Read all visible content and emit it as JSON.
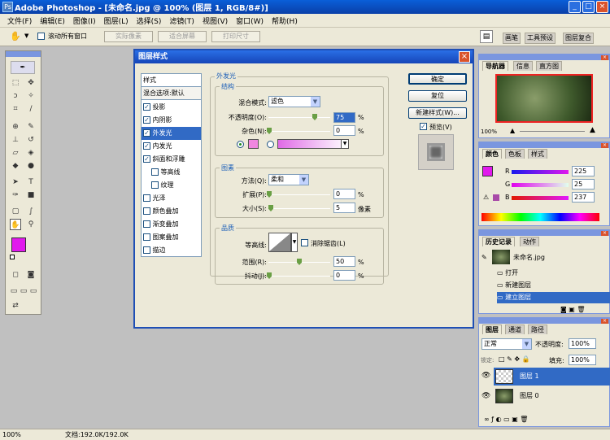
{
  "window": {
    "title": "Adobe Photoshop - [未命名.jpg @ 100% (图层 1, RGB/8#)]"
  },
  "menu": [
    "文件(F)",
    "编辑(E)",
    "图像(I)",
    "图层(L)",
    "选择(S)",
    "滤镜(T)",
    "视图(V)",
    "窗口(W)",
    "帮助(H)"
  ],
  "options": {
    "scroll_all": "滚动所有窗口",
    "actual_pixels": "实际像素",
    "fit_screen": "适合屏幕",
    "print_size": "打印尺寸"
  },
  "palette_well": [
    "画笔",
    "工具预设",
    "图层复合"
  ],
  "status": {
    "zoom": "100%",
    "doc": "文档:192.0K/192.0K"
  },
  "dialog": {
    "title": "图层样式",
    "styles": {
      "header": "样式",
      "blend_defaults": "混合选项:默认",
      "items": [
        {
          "label": "投影",
          "checked": true
        },
        {
          "label": "内阴影",
          "checked": true
        },
        {
          "label": "外发光",
          "checked": true
        },
        {
          "label": "内发光",
          "checked": true
        },
        {
          "label": "斜面和浮雕",
          "checked": true
        },
        {
          "label": "等高线",
          "checked": false
        },
        {
          "label": "纹理",
          "checked": false
        },
        {
          "label": "光泽",
          "checked": false
        },
        {
          "label": "颜色叠加",
          "checked": false
        },
        {
          "label": "渐变叠加",
          "checked": false
        },
        {
          "label": "图案叠加",
          "checked": false
        },
        {
          "label": "描边",
          "checked": false
        }
      ]
    },
    "outer_glow": {
      "title": "外发光",
      "structure": {
        "title": "结构",
        "blend_mode_label": "混合模式:",
        "blend_mode": "滤色",
        "opacity_label": "不透明度(O):",
        "opacity": "75",
        "noise_label": "杂色(N):",
        "noise": "0",
        "percent": "%",
        "color": "#f087e0"
      },
      "elements": {
        "title": "图素",
        "method_label": "方法(Q):",
        "method": "柔和",
        "spread_label": "扩展(P):",
        "spread": "0",
        "size_label": "大小(S):",
        "size": "5",
        "pixels": "像素"
      },
      "quality": {
        "title": "品质",
        "contour_label": "等高线:",
        "antialias": "消除锯齿(L)",
        "range_label": "范围(R):",
        "range": "50",
        "jitter_label": "抖动(J):",
        "jitter": "0"
      }
    },
    "buttons": {
      "ok": "确定",
      "reset": "复位",
      "new_style": "新建样式(W)...",
      "preview": "预览(V)"
    }
  },
  "navigator": {
    "tabs": [
      "导航器",
      "信息",
      "直方图"
    ],
    "zoom": "100%"
  },
  "color_panel": {
    "tabs": [
      "颜色",
      "色板",
      "样式"
    ],
    "r_label": "R",
    "g_label": "G",
    "b_label": "B",
    "r": "225",
    "g": "25",
    "b": "237",
    "foreground": "#e119ed"
  },
  "history": {
    "tabs": [
      "历史记录",
      "动作"
    ],
    "snapshot": "未命名.jpg",
    "steps": [
      "打开",
      "新建图层",
      "建立图层"
    ]
  },
  "layers": {
    "tabs": [
      "图层",
      "通道",
      "路径"
    ],
    "mode": "正常",
    "opacity_label": "不透明度:",
    "opacity": "100%",
    "lock_label": "锁定:",
    "fill_label": "填充:",
    "fill": "100%",
    "items": [
      "图层 1",
      "图层 0"
    ]
  }
}
